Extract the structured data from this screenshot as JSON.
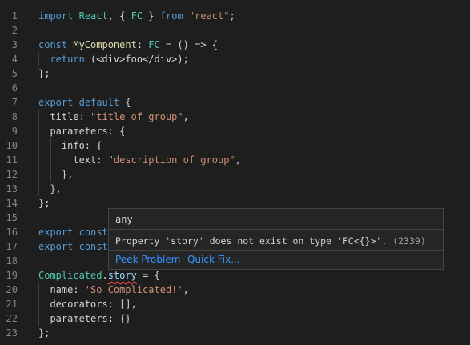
{
  "editor": {
    "lines": [
      {
        "num": "1",
        "tokens": [
          [
            "kw",
            "import"
          ],
          [
            "plain",
            " "
          ],
          [
            "ty",
            "React"
          ],
          [
            "plain",
            ", { "
          ],
          [
            "ty",
            "FC"
          ],
          [
            "plain",
            " } "
          ],
          [
            "kw",
            "from"
          ],
          [
            "plain",
            " "
          ],
          [
            "str",
            "\"react\""
          ],
          [
            "plain",
            ";"
          ]
        ]
      },
      {
        "num": "2",
        "tokens": []
      },
      {
        "num": "3",
        "tokens": [
          [
            "kw",
            "const"
          ],
          [
            "plain",
            " "
          ],
          [
            "fn",
            "MyComponent"
          ],
          [
            "plain",
            ": "
          ],
          [
            "ty",
            "FC"
          ],
          [
            "plain",
            " = () => {"
          ]
        ]
      },
      {
        "num": "4",
        "tokens": [
          [
            "plain",
            "  "
          ],
          [
            "kw",
            "return"
          ],
          [
            "plain",
            " (<div>foo</div>);"
          ]
        ]
      },
      {
        "num": "5",
        "tokens": [
          [
            "plain",
            "};"
          ]
        ]
      },
      {
        "num": "6",
        "tokens": []
      },
      {
        "num": "7",
        "tokens": [
          [
            "kw",
            "export"
          ],
          [
            "plain",
            " "
          ],
          [
            "kw",
            "default"
          ],
          [
            "plain",
            " {"
          ]
        ]
      },
      {
        "num": "8",
        "tokens": [
          [
            "plain",
            "  title: "
          ],
          [
            "str",
            "\"title of group\""
          ],
          [
            "plain",
            ","
          ]
        ]
      },
      {
        "num": "9",
        "tokens": [
          [
            "plain",
            "  parameters: {"
          ]
        ]
      },
      {
        "num": "10",
        "tokens": [
          [
            "plain",
            "    info: {"
          ]
        ]
      },
      {
        "num": "11",
        "tokens": [
          [
            "plain",
            "      text: "
          ],
          [
            "str",
            "\"description of group\""
          ],
          [
            "plain",
            ","
          ]
        ]
      },
      {
        "num": "12",
        "tokens": [
          [
            "plain",
            "    },"
          ]
        ]
      },
      {
        "num": "13",
        "tokens": [
          [
            "plain",
            "  },"
          ]
        ]
      },
      {
        "num": "14",
        "tokens": [
          [
            "plain",
            "};"
          ]
        ]
      },
      {
        "num": "15",
        "tokens": []
      },
      {
        "num": "16",
        "tokens": [
          [
            "kw",
            "export"
          ],
          [
            "plain",
            " "
          ],
          [
            "kw",
            "const"
          ]
        ]
      },
      {
        "num": "17",
        "tokens": [
          [
            "kw",
            "export"
          ],
          [
            "plain",
            " "
          ],
          [
            "kw",
            "const"
          ]
        ]
      },
      {
        "num": "18",
        "tokens": []
      },
      {
        "num": "19",
        "tokens": [
          [
            "ty",
            "Complicated"
          ],
          [
            "plain",
            "."
          ],
          [
            "squiggle",
            "story"
          ],
          [
            "plain",
            " = {"
          ]
        ]
      },
      {
        "num": "20",
        "tokens": [
          [
            "plain",
            "  name: "
          ],
          [
            "str",
            "'So Complicated!'"
          ],
          [
            "plain",
            ","
          ]
        ]
      },
      {
        "num": "21",
        "tokens": [
          [
            "plain",
            "  decorators: [],"
          ]
        ]
      },
      {
        "num": "22",
        "tokens": [
          [
            "plain",
            "  parameters: {}"
          ]
        ]
      },
      {
        "num": "23",
        "tokens": [
          [
            "plain",
            "};"
          ]
        ]
      }
    ]
  },
  "hover": {
    "signature": "any",
    "message": "Property 'story' does not exist on type 'FC<{}>'.",
    "error_code": "(2339)",
    "peek_label": "Peek Problem",
    "quickfix_label": "Quick Fix..."
  }
}
